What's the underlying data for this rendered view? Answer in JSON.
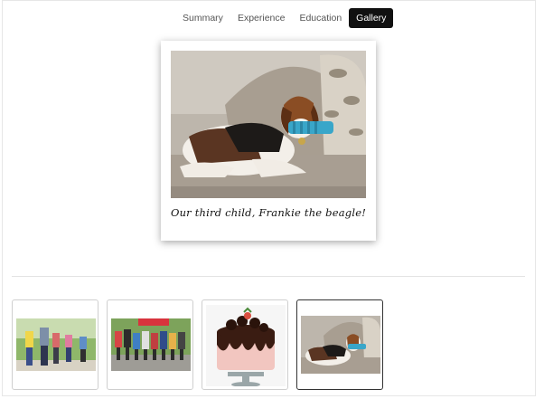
{
  "tabs": [
    {
      "label": "Summary",
      "active": false
    },
    {
      "label": "Experience",
      "active": false
    },
    {
      "label": "Education",
      "active": false
    },
    {
      "label": "Gallery",
      "active": true
    }
  ],
  "gallery": {
    "featured_caption": "Our third child, Frankie the beagle!",
    "thumbnails": [
      {
        "subject": "people walking outdoors",
        "selected": false
      },
      {
        "subject": "running race",
        "selected": false
      },
      {
        "subject": "chocolate drip cake",
        "selected": false
      },
      {
        "subject": "beagle on couch",
        "selected": true
      }
    ]
  },
  "colors": {
    "active_tab_bg": "#111111",
    "active_tab_text": "#ffffff",
    "tab_text": "#555555"
  }
}
